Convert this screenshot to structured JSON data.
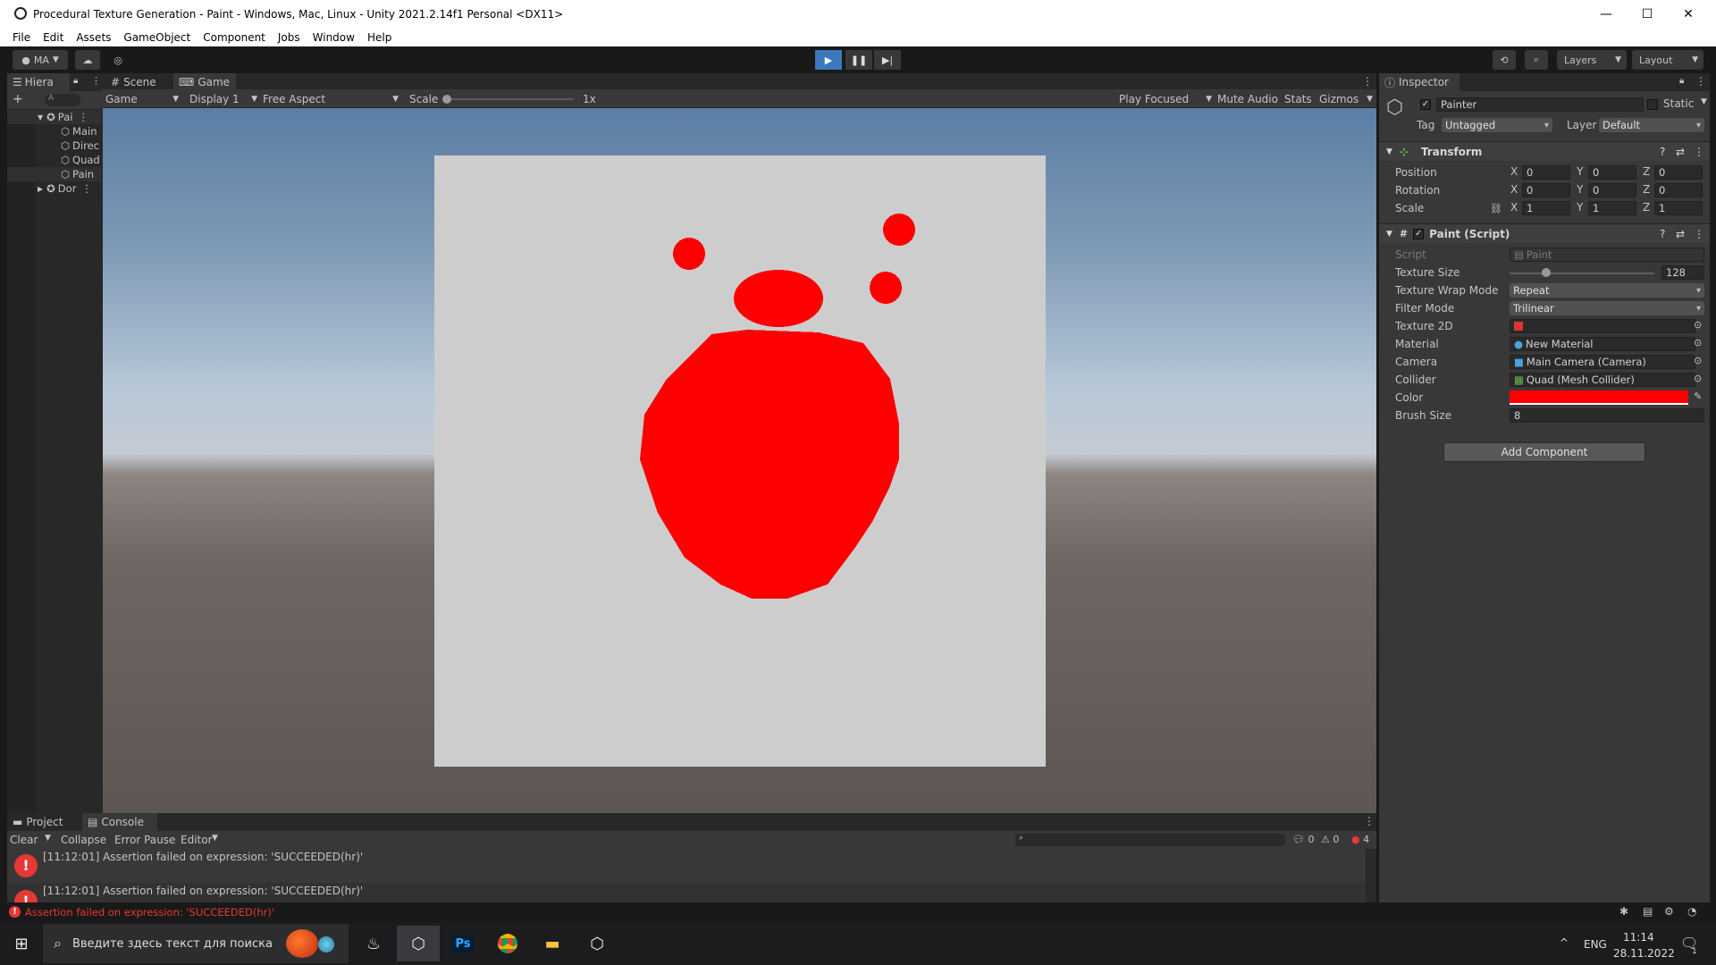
{
  "window": {
    "title": "Procedural Texture Generation - Paint - Windows, Mac, Linux - Unity 2021.2.14f1 Personal <DX11>",
    "minimize": "—",
    "maximize": "☐",
    "close": "✕"
  },
  "menu": [
    "File",
    "Edit",
    "Assets",
    "GameObject",
    "Component",
    "Jobs",
    "Window",
    "Help"
  ],
  "toolbar": {
    "account": "MA",
    "layers": "Layers",
    "layout": "Layout"
  },
  "hierarchy": {
    "tab": "Hiera",
    "search_placeholder": "A",
    "items": [
      {
        "label": "Pai",
        "icon": "unity-scene-icon"
      },
      {
        "label": "Main",
        "icon": "gameobject-cube-icon"
      },
      {
        "label": "Direc",
        "icon": "gameobject-cube-icon"
      },
      {
        "label": "Quad",
        "icon": "gameobject-cube-icon"
      },
      {
        "label": "Pain",
        "icon": "gameobject-cube-icon"
      },
      {
        "label": "Dor",
        "icon": "unity-scene-icon"
      }
    ]
  },
  "game_tabs": {
    "scene": "Scene",
    "game": "Game"
  },
  "game_toolbar": {
    "mode": "Game",
    "display": "Display 1",
    "aspect": "Free Aspect",
    "scale_label": "Scale",
    "scale_value": "1x",
    "play_focused": "Play Focused",
    "mute": "Mute Audio",
    "stats": "Stats",
    "gizmos": "Gizmos"
  },
  "inspector": {
    "tab": "Inspector",
    "object_name": "Painter",
    "static_label": "Static",
    "tag_label": "Tag",
    "tag_value": "Untagged",
    "layer_label": "Layer",
    "layer_value": "Default",
    "transform": {
      "title": "Transform",
      "position_label": "Position",
      "rotation_label": "Rotation",
      "scale_label": "Scale",
      "position": [
        "0",
        "0",
        "0"
      ],
      "rotation": [
        "0",
        "0",
        "0"
      ],
      "scale": [
        "1",
        "1",
        "1"
      ],
      "x": "X",
      "y": "Y",
      "z": "Z"
    },
    "paint": {
      "title": "Paint (Script)",
      "script_label": "Script",
      "script_value": "Paint",
      "texture_size_label": "Texture Size",
      "texture_size_value": "128",
      "texture_size_fraction": 0.25,
      "wrap_label": "Texture Wrap Mode",
      "wrap_value": "Repeat",
      "filter_label": "Filter Mode",
      "filter_value": "Trilinear",
      "texture2d_label": "Texture 2D",
      "material_label": "Material",
      "material_value": "New Material",
      "camera_label": "Camera",
      "camera_value": "Main Camera (Camera)",
      "collider_label": "Collider",
      "collider_value": "Quad (Mesh Collider)",
      "color_label": "Color",
      "color_value": "#ff0000",
      "brush_label": "Brush Size",
      "brush_value": "8"
    },
    "add_component": "Add Component"
  },
  "console": {
    "project_tab": "Project",
    "console_tab": "Console",
    "clear": "Clear",
    "collapse": "Collapse",
    "error_pause": "Error Pause",
    "editor": "Editor",
    "log_count": "0",
    "warn_count": "0",
    "error_count": "4",
    "messages": [
      "[11:12:01] Assertion failed on expression: 'SUCCEEDED(hr)'",
      "[11:12:01] Assertion failed on expression: 'SUCCEEDED(hr)'"
    ],
    "status": "Assertion failed on expression: 'SUCCEEDED(hr)'"
  },
  "taskbar": {
    "search_placeholder": "Введите здесь текст для поиска",
    "lang": "ENG",
    "time": "11:14",
    "date": "28.11.2022",
    "notif_count": "1"
  },
  "colors": {
    "paint_red": "#ff0000",
    "quad": "#cdcdcd",
    "error_red": "#e53935",
    "play_blue": "#3a79bb"
  }
}
